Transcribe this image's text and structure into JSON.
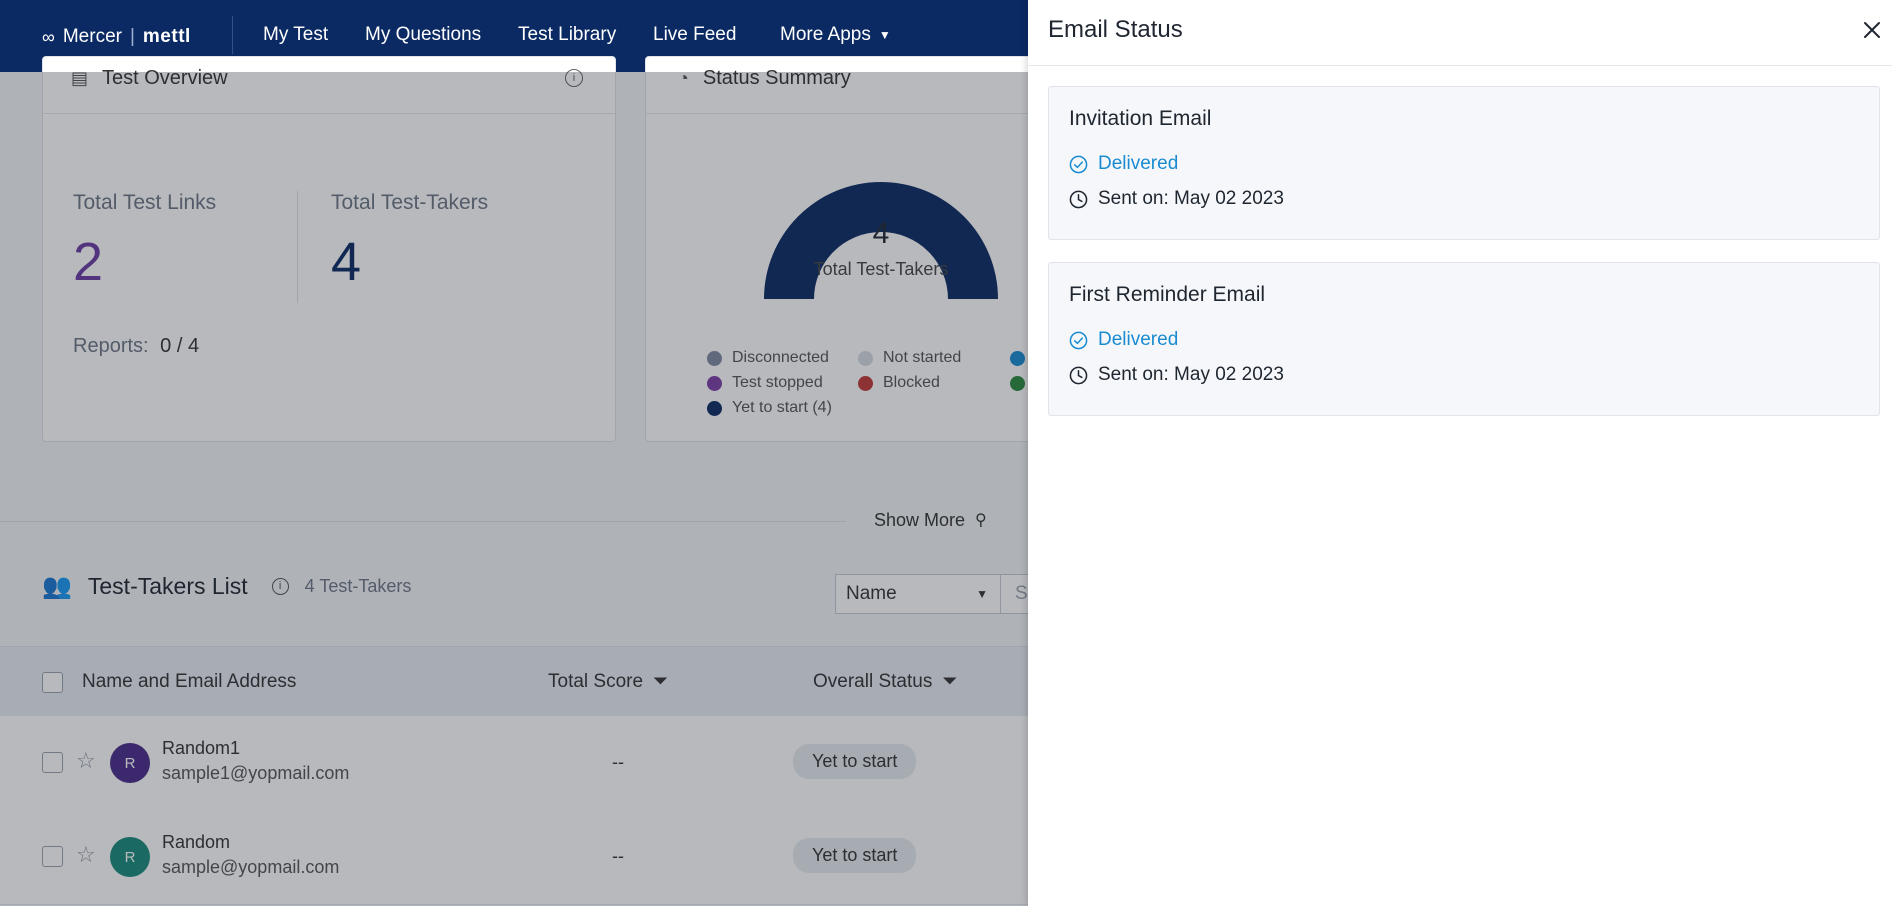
{
  "nav": {
    "brand": "Mercer",
    "brand_sub": "mettl",
    "items": [
      "My Test",
      "My Questions",
      "Test Library",
      "Live Feed"
    ],
    "more": "More Apps"
  },
  "overview": {
    "title": "Test Overview",
    "links_label": "Total Test Links",
    "links_value": "2",
    "takers_label": "Total Test-Takers",
    "takers_value": "4",
    "reports_label": "Reports:",
    "reports_value": "0 / 4"
  },
  "status_summary": {
    "title": "Status Summary",
    "center_value": "4",
    "center_label": "Total Test-Takers",
    "legend": [
      {
        "label": "Disconnected",
        "color": "#7f8aa3"
      },
      {
        "label": "Not started",
        "color": "#d6dbe4"
      },
      {
        "label": "Test stopped",
        "color": "#7b3fa6"
      },
      {
        "label": "Blocked",
        "color": "#c23a3a"
      },
      {
        "label": "Yet to start (4)",
        "color": "#0b2a63"
      }
    ],
    "donut_color": "#0b2a63"
  },
  "show_more": "Show More",
  "list": {
    "title": "Test-Takers List",
    "count": "4 Test-Takers",
    "filter_value": "Name",
    "search_placeholder": "Se",
    "columns": [
      "Name and Email Address",
      "Total Score",
      "Overall Status"
    ],
    "rows": [
      {
        "initial": "R",
        "name": "Random1",
        "email": "sample1@yopmail.com",
        "score": "--",
        "status": "Yet to start",
        "avatar_color": "#4b2a8a"
      },
      {
        "initial": "R",
        "name": "Random",
        "email": "sample@yopmail.com",
        "score": "--",
        "status": "Yet to start",
        "avatar_color": "#1a8a7d"
      }
    ]
  },
  "drawer": {
    "title": "Email Status",
    "emails": [
      {
        "title": "Invitation Email",
        "status": "Delivered",
        "sent": "Sent on: May 02 2023"
      },
      {
        "title": "First Reminder Email",
        "status": "Delivered",
        "sent": "Sent on: May 02 2023"
      }
    ]
  }
}
